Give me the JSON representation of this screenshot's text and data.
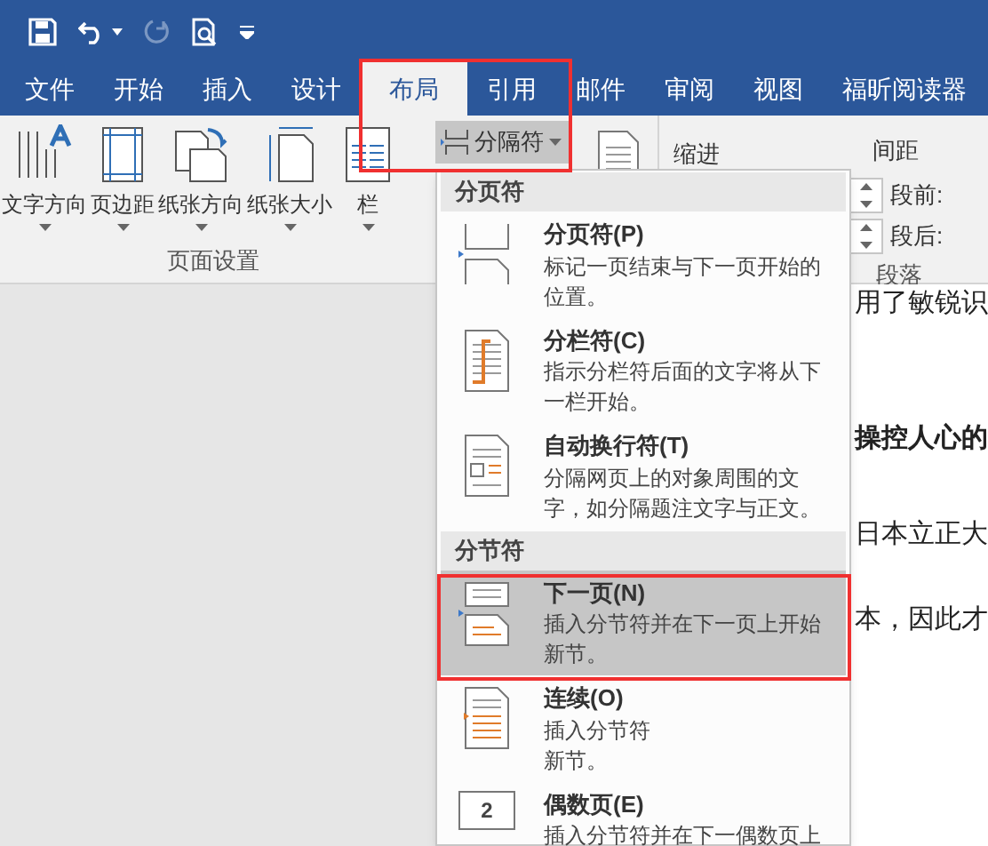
{
  "tabs": [
    {
      "label": "文件",
      "selected": false
    },
    {
      "label": "开始",
      "selected": false
    },
    {
      "label": "插入",
      "selected": false
    },
    {
      "label": "设计",
      "selected": false
    },
    {
      "label": "布局",
      "selected": true
    },
    {
      "label": "引用",
      "selected": false
    },
    {
      "label": "邮件",
      "selected": false
    },
    {
      "label": "审阅",
      "selected": false
    },
    {
      "label": "视图",
      "selected": false
    },
    {
      "label": "福昕阅读器",
      "selected": false
    }
  ],
  "ribbon": {
    "page_setup": {
      "buttons": [
        {
          "kind": "text-direction",
          "label": "文字方向"
        },
        {
          "kind": "margins",
          "label": "页边距"
        },
        {
          "kind": "orientation",
          "label": "纸张方向"
        },
        {
          "kind": "size",
          "label": "纸张大小"
        },
        {
          "kind": "columns",
          "label": "栏"
        }
      ],
      "group_label": "页面设置"
    },
    "breaks_button": {
      "label": "分隔符",
      "selected": true
    },
    "indent_label": "缩进",
    "spacing_label": "间距",
    "before_label": "段前:",
    "after_label": "段后:",
    "paragraph_label": "段落"
  },
  "document_lines": [
    {
      "text": "用了敏锐识",
      "bold": false
    },
    {
      "text": "操控人心的",
      "bold": true
    },
    {
      "text": "日本立正大",
      "bold": false
    },
    {
      "text": "本，因此才",
      "bold": false
    }
  ],
  "menu": [
    {
      "heading": "分页符",
      "items": [
        {
          "kind": "page",
          "title": "分页符(P)",
          "description": "标记一页结束与下一页开始的位置。",
          "selected": false
        },
        {
          "kind": "column",
          "title": "分栏符(C)",
          "description": "指示分栏符后面的文字将从下一栏开始。",
          "selected": false
        },
        {
          "kind": "wrap",
          "title": "自动换行符(T)",
          "description": "分隔网页上的对象周围的文字，如分隔题注文字与正文。",
          "selected": false
        }
      ]
    },
    {
      "heading": "分节符",
      "items": [
        {
          "kind": "next-page",
          "title": "下一页(N)",
          "description": "插入分节符并在下一页上开始新节。",
          "selected": true
        },
        {
          "kind": "continuous",
          "title": "连续(O)",
          "description": "插入分节符",
          "description_2": "新节。",
          "selected": false
        },
        {
          "kind": "even-page",
          "title": "偶数页(E)",
          "icon_label": "2",
          "description": "插入分节符并在下一偶数页上",
          "selected": false
        }
      ]
    }
  ]
}
